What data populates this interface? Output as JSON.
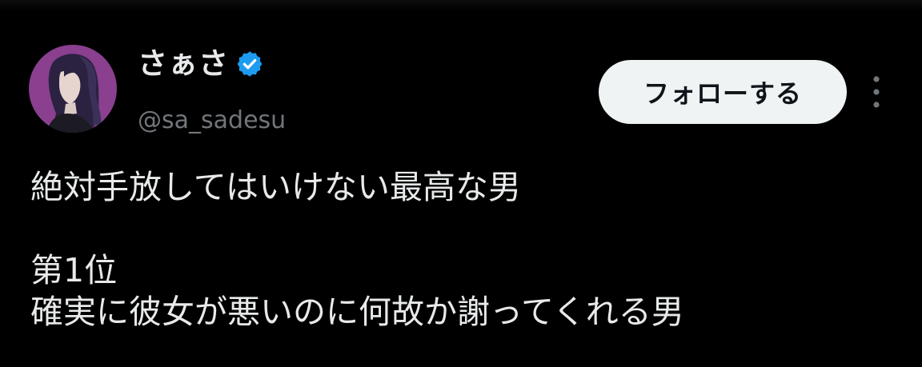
{
  "author": {
    "display_name": "さぁさ",
    "handle": "@sa_sadesu",
    "verified_icon": "verified-badge-icon",
    "avatar_icon": "profile-avatar"
  },
  "actions": {
    "follow_label": "フォローする",
    "more_icon": "more-vertical-icon"
  },
  "tweet": {
    "line1": "絶対手放してはいけない最高な男",
    "line2": "第1位",
    "line3": "確実に彼女が悪いのに何故か謝ってくれる男"
  },
  "colors": {
    "background": "#000000",
    "text_primary": "#e7e9ea",
    "text_secondary": "#71767b",
    "verified_blue": "#1d9bf0",
    "follow_bg": "#eff3f4",
    "follow_text": "#0f1419",
    "avatar_bg": "#8a3f8f"
  }
}
